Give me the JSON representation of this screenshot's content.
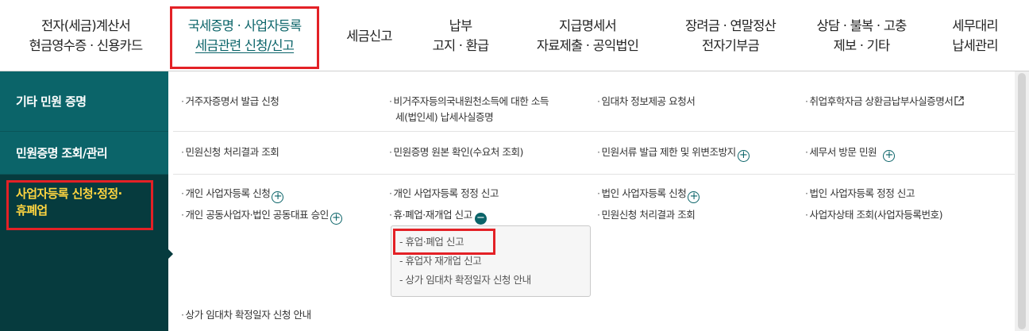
{
  "nav": {
    "items": [
      {
        "l1": "전자(세금)계산서",
        "l2": "현금영수증 · 신용카드"
      },
      {
        "l1": "국세증명 · 사업자등록",
        "l2": "세금관련 신청/신고"
      },
      {
        "l1": "세금신고",
        "l2": ""
      },
      {
        "l1": "납부",
        "l2": "고지 · 환급"
      },
      {
        "l1": "지급명세서",
        "l2": "자료제출 · 공익법인"
      },
      {
        "l1": "장려금 · 연말정산",
        "l2": "전자기부금"
      },
      {
        "l1": "상담 · 불복 · 고충",
        "l2": "제보 · 기타"
      },
      {
        "l1": "세무대리",
        "l2": "납세관리"
      }
    ]
  },
  "menu": {
    "rows": [
      {
        "label": "기타 민원 증명"
      },
      {
        "label": "민원증명 조회/관리"
      },
      {
        "label_line1": "사업자등록 신청·정정·",
        "label_line2": "휴폐업"
      }
    ]
  },
  "content": {
    "row1": {
      "c1": "거주자증명서 발급 신청",
      "c2_line1": "비거주자등의국내원천소득에 대한 소득",
      "c2_line2": "세(법인세) 납세사실증명",
      "c3": "임대차 정보제공 요청서",
      "c4": "취업후학자금 상환금납부사실증명서"
    },
    "row2": {
      "c1": "민원신청 처리결과 조회",
      "c2": "민원증명 원본 확인(수요처 조회)",
      "c3": "민원서류 발급 제한 및 위변조방지",
      "c4": "세무서 방문 민원"
    },
    "row3": {
      "c1a": "개인 사업자등록 신청",
      "c1b": "개인 공동사업자·법인 공동대표 승인",
      "c2a": "개인 사업자등록 정정 신고",
      "c2b": "휴·폐업·재개업 신고",
      "c3a": "법인 사업자등록 신청",
      "c3b": "민원신청 처리결과 조회",
      "c4a": "법인 사업자등록 정정 신고",
      "c4b": "사업자상태 조회(사업자등록번호)",
      "c1c": "상가 임대차 확정일자 신청 안내"
    },
    "dropdown": [
      "- 휴업·폐업 신고",
      "- 휴업자 재개업 신고",
      "- 상가 임대차 확정일자 신청 안내"
    ]
  },
  "colors": {
    "menu_bg": "#0b6469",
    "menu_selected_bg": "#063b3e",
    "menu_selected_text": "#ffd540",
    "highlight": "#e32126"
  }
}
